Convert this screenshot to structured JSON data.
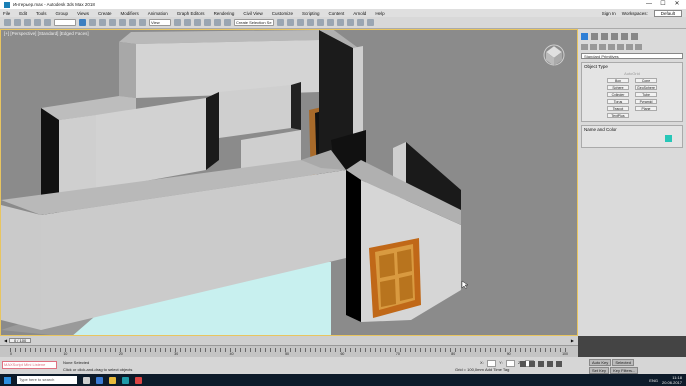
{
  "window": {
    "title": "Интерьер.max - Autodesk 3ds Max 2018",
    "min_glyph": "—",
    "max_glyph": "☐",
    "close_glyph": "✕"
  },
  "menu": {
    "items": [
      "File",
      "Edit",
      "Tools",
      "Group",
      "Views",
      "Create",
      "Modifiers",
      "Animation",
      "Graph Editors",
      "Rendering",
      "Civil View",
      "Customize",
      "Scripting",
      "Content",
      "Arnold",
      "Help"
    ],
    "sign_in": "Sign In",
    "workspaces_label": "Workspaces:",
    "workspace_value": "Default"
  },
  "toolbar": {
    "view_dropdown": "View",
    "selection_set": "Create Selection Se"
  },
  "viewport": {
    "label": "[+] [Perspective] [Standard] [Edged Faces]"
  },
  "command_panel": {
    "category_dropdown": "Standard Primitives",
    "object_type_title": "Object Type",
    "autogrid_label": "AutoGrid",
    "object_buttons": [
      "Box",
      "Cone",
      "Sphere",
      "GeoSphere",
      "Cylinder",
      "Tube",
      "Torus",
      "Pyramid",
      "Teapot",
      "Plane",
      "TextPlus"
    ],
    "name_color_title": "Name and Color",
    "object_color": "#27c7b8"
  },
  "timeline": {
    "frame_display": "0 / 100",
    "ticks": [
      "0",
      "10",
      "20",
      "30",
      "40",
      "50",
      "60",
      "70",
      "80",
      "90",
      "100"
    ]
  },
  "status": {
    "maxscript": "MAXScript Mini Listene",
    "selection": "None Selected",
    "prompt": "Click or click-and-drag to select objects",
    "x_label": "X:",
    "y_label": "Y:",
    "z_label": "Z:",
    "grid": "Grid = 100,0mm",
    "add_time_tag": "Add Time Tag",
    "auto_key": "Auto Key",
    "set_key": "Set Key",
    "key_filters": "Key Filters...",
    "selected": "Selected"
  },
  "taskbar": {
    "search_placeholder": "Type here to search",
    "lang": "ENG",
    "time": "11:18",
    "date": "20.06.2017"
  }
}
